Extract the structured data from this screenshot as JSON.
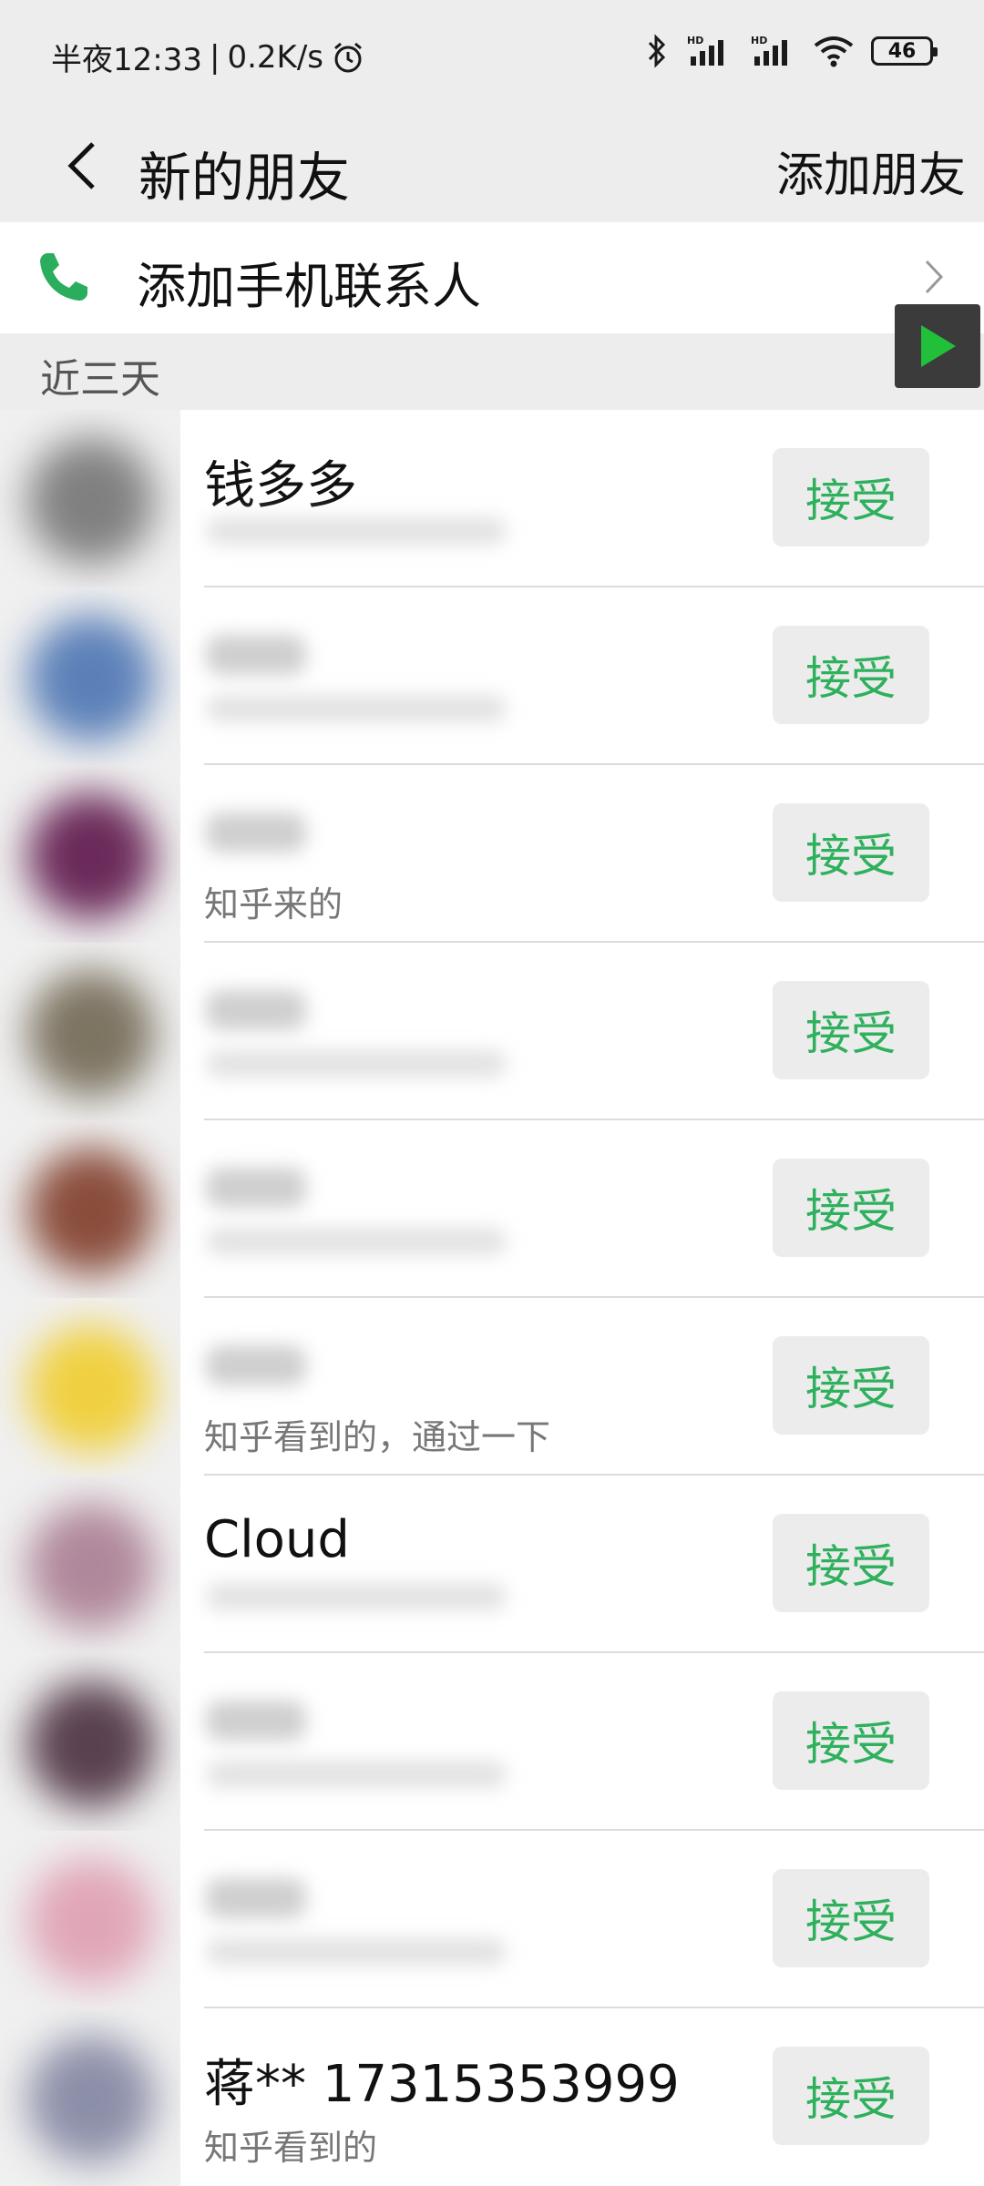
{
  "status_bar": {
    "time_label": "半夜12:33",
    "speed": "0.2K/s",
    "battery": "46"
  },
  "nav": {
    "title": "新的朋友",
    "action": "添加朋友"
  },
  "add_contacts": {
    "label": "添加手机联系人"
  },
  "section": {
    "title": "近三天"
  },
  "requests": [
    {
      "name": "钱多多",
      "remark": "",
      "button": "接受",
      "avatar_color": "#808080"
    },
    {
      "name": "",
      "remark": "",
      "button": "接受",
      "avatar_color": "#5b80b8"
    },
    {
      "name": "",
      "remark": "知乎来的",
      "button": "接受",
      "avatar_color": "#6b2a5a"
    },
    {
      "name": "",
      "remark": "",
      "button": "接受",
      "avatar_color": "#7d7462"
    },
    {
      "name": "",
      "remark": "",
      "button": "接受",
      "avatar_color": "#8a4d3c"
    },
    {
      "name": "",
      "remark": "知乎看到的，通过一下",
      "button": "接受",
      "avatar_color": "#f0d040"
    },
    {
      "name": "Cloud",
      "remark": "",
      "button": "接受",
      "avatar_color": "#b0889b"
    },
    {
      "name": "",
      "remark": "",
      "button": "接受",
      "avatar_color": "#5a4150"
    },
    {
      "name": "",
      "remark": "",
      "button": "接受",
      "avatar_color": "#e0a6b8"
    },
    {
      "name": "蒋** 17315353999",
      "remark": "知乎看到的",
      "button": "接受",
      "avatar_color": "#8c8fa8"
    }
  ]
}
